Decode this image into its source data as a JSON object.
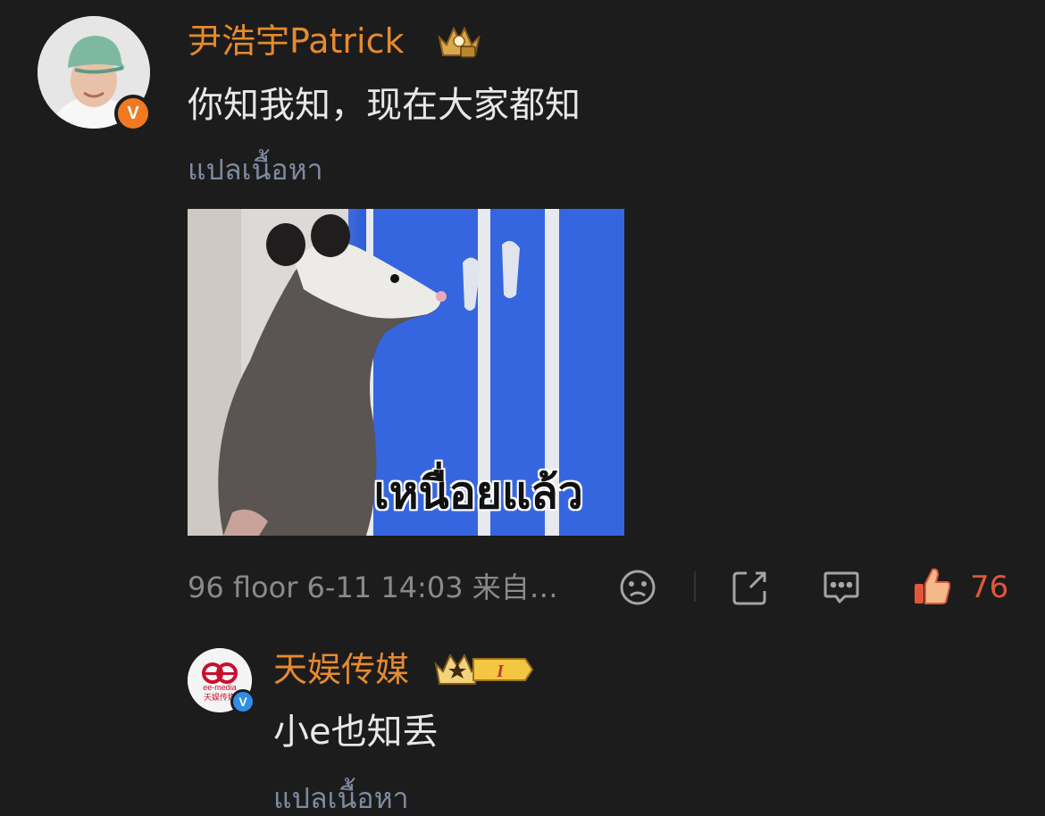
{
  "comment": {
    "username": "尹浩宇Patrick",
    "text": "你知我知，现在大家都知",
    "translate_label": "แปลเนื้อหา",
    "image_caption": "เหนื่อยแล้ว",
    "meta": "96 floor 6-11 14:03 来自…",
    "like_count": "76",
    "badge": "V"
  },
  "reply": {
    "username": "天娱传媒",
    "text": "小e也知丢",
    "translate_label": "แปลเนื้อหา",
    "avatar_logo": "ee-media",
    "avatar_sub": "天娱传媒",
    "level_badge": "I",
    "badge": "V"
  },
  "icons": {
    "vip": "crown-badge-icon",
    "dislike": "sad-face-icon",
    "share": "share-icon",
    "reply": "comment-icon",
    "like": "thumbs-up-icon"
  },
  "colors": {
    "background": "#1c1c1c",
    "username": "#e58a2f",
    "like": "#e0573a",
    "verified": "#f07a21"
  }
}
